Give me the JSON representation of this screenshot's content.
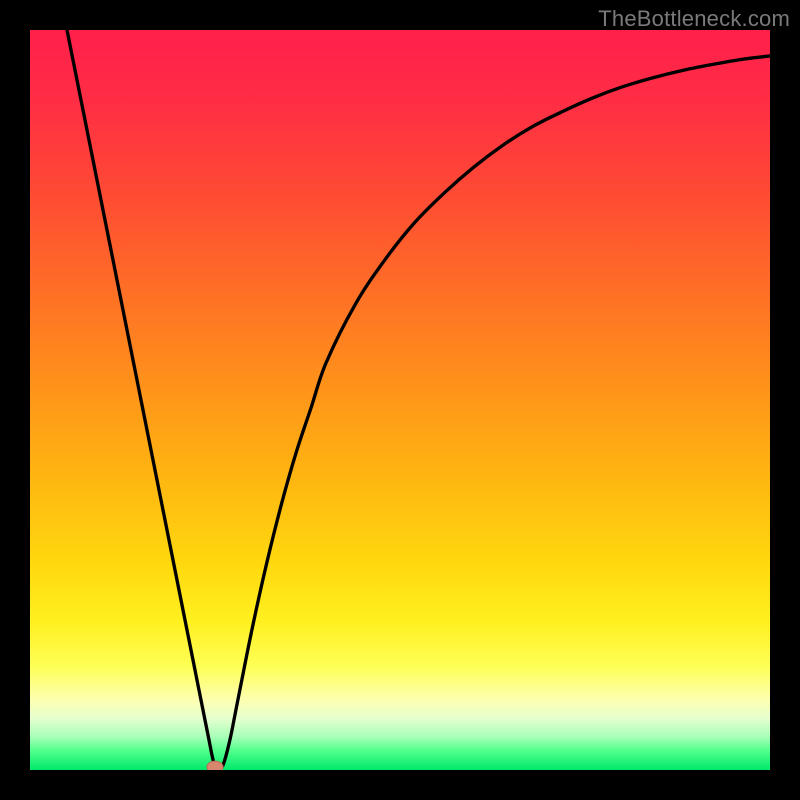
{
  "watermark": "TheBottleneck.com",
  "colors": {
    "frame": "#000000",
    "curve": "#000000",
    "marker_fill": "#d8876f",
    "marker_stroke": "#b86a56",
    "gradient_stops": [
      {
        "offset": 0.0,
        "color": "#ff1f4b"
      },
      {
        "offset": 0.1,
        "color": "#ff2e44"
      },
      {
        "offset": 0.22,
        "color": "#ff4a34"
      },
      {
        "offset": 0.35,
        "color": "#ff6e26"
      },
      {
        "offset": 0.48,
        "color": "#ff921a"
      },
      {
        "offset": 0.6,
        "color": "#ffb411"
      },
      {
        "offset": 0.72,
        "color": "#ffd80e"
      },
      {
        "offset": 0.8,
        "color": "#fff020"
      },
      {
        "offset": 0.86,
        "color": "#feff56"
      },
      {
        "offset": 0.905,
        "color": "#fdffb0"
      },
      {
        "offset": 0.93,
        "color": "#e6ffcf"
      },
      {
        "offset": 0.955,
        "color": "#a8ffb8"
      },
      {
        "offset": 0.975,
        "color": "#4eff8b"
      },
      {
        "offset": 1.0,
        "color": "#00e86b"
      }
    ]
  },
  "chart_data": {
    "type": "line",
    "title": "",
    "xlabel": "",
    "ylabel": "",
    "xlim": [
      0,
      100
    ],
    "ylim": [
      0,
      100
    ],
    "grid": false,
    "series": [
      {
        "name": "curve",
        "x": [
          5,
          6,
          8,
          10,
          12,
          14,
          16,
          18,
          20,
          22,
          24,
          25,
          26,
          27,
          28,
          30,
          32,
          34,
          36,
          38,
          40,
          44,
          48,
          52,
          56,
          60,
          64,
          68,
          72,
          76,
          80,
          84,
          88,
          92,
          96,
          100
        ],
        "values": [
          100,
          95,
          85,
          75,
          65,
          55,
          45,
          35,
          25,
          15,
          5,
          0.5,
          0.5,
          4,
          9,
          19,
          28,
          36,
          43,
          49,
          55,
          63,
          69,
          74,
          78,
          81.5,
          84.5,
          87,
          89,
          90.8,
          92.3,
          93.5,
          94.5,
          95.3,
          96,
          96.5
        ]
      }
    ],
    "marker": {
      "x": 25,
      "y": 0.4,
      "rx": 1.1,
      "ry": 0.8
    }
  }
}
